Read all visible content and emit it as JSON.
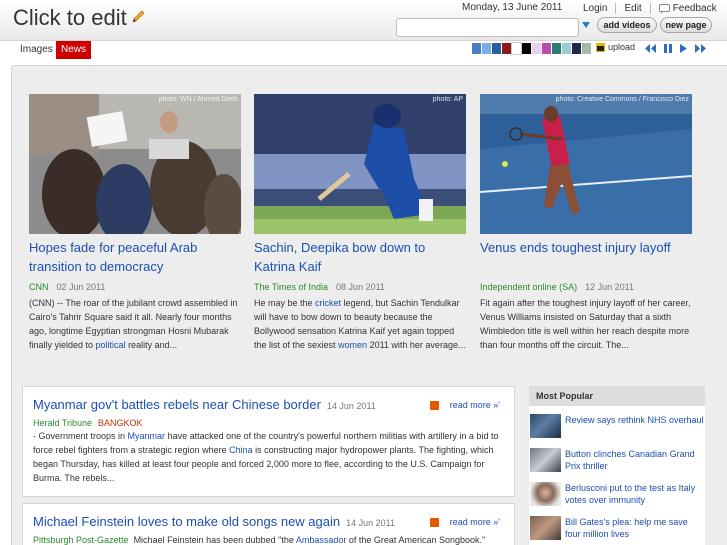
{
  "header": {
    "site_title": "Click to edit",
    "date": "Monday, 13 June 2011",
    "links": {
      "login": "Login",
      "edit": "Edit",
      "feedback": "Feedback"
    },
    "search": {
      "value": "",
      "placeholder": ""
    },
    "buttons": {
      "add_videos": "add videos",
      "new_page": "new page"
    }
  },
  "toolbar": {
    "tabs": [
      {
        "label": "Images",
        "active": false
      },
      {
        "label": "News",
        "active": true
      }
    ],
    "swatch_colors": [
      "#4a7dc6",
      "#7baee0",
      "#2a5ca0",
      "#8b1a1a",
      "#ffffff",
      "#000000",
      "#e8d0ef",
      "#b74ea8",
      "#2b7a7a",
      "#9ccbd4",
      "#1f2a4a",
      "#a8b8a8"
    ],
    "upload_label": "upload",
    "accent_color": "#cc0000"
  },
  "featured": [
    {
      "credit": "photo: WN / Ahmed Deeb",
      "title": "Hopes fade for peaceful Arab transition to democracy",
      "source": "CNN",
      "date": "02 Jun 2011",
      "summary": {
        "before": "(CNN) -- The roar of the jubilant crowd assembled in Cairo's Tahrir Square said it all. Nearly four months ago, longtime Egyptian strongman Hosni Mubarak finally yielded to ",
        "link": "political",
        "after": " reality and..."
      }
    },
    {
      "credit": "photo: AP",
      "title": "Sachin, Deepika bow down to Katrina Kaif",
      "source": "The Times of India",
      "date": "08 Jun 2011",
      "summary": {
        "before": "He may be the ",
        "link": "cricket",
        "mid": " legend, but Sachin Tendulkar will have to bow down to beauty because the Bollywood sensation Katrina Kaif yet again topped the list of the sexiest ",
        "link2": "women",
        "after": " 2011 with her average..."
      }
    },
    {
      "credit": "photo: Creative Commons / Francisco Diez",
      "title": "Venus ends toughest injury layoff",
      "source": "Independent online (SA)",
      "date": "12 Jun 2011",
      "summary": {
        "before": "Fit again after the toughest injury layoff of her career, Venus Williams insisted on Saturday that a sixth Wimbledon title is well within her reach despite more than four months off the circuit. The...",
        "link": "",
        "after": ""
      }
    }
  ],
  "stories": [
    {
      "title": "Myanmar gov't battles rebels near Chinese border",
      "date": "14 Jun 2011",
      "read_more": "read more",
      "source": "Herald Tribune",
      "location": "BANGKOK",
      "body": {
        "t1": " - Government troops in ",
        "l1": "Myanmar",
        "t2": " have attacked one of the country's powerful northern militias with artillery in a bid to force rebel fighters from a strategic region where ",
        "l2": "China",
        "t3": " is constructing major hydropower plants. The fighting, which began Thursday, has killed at least four people and forced 2,000 more to flee, according to the U.S. Campaign for Burma. The rebels..."
      }
    },
    {
      "title": "Michael Feinstein loves to make old songs new again",
      "date": "14 Jun 2011",
      "read_more": "read more",
      "source": "Pittsburgh Post-Gazette",
      "location": "",
      "body": {
        "t1": "Michael Feinstein has been dubbed \"the ",
        "l1": "Ambassador",
        "t2": " of the Great American Songbook.\"",
        "l2": "",
        "t3": ""
      }
    }
  ],
  "most_popular": {
    "heading": "Most Popular",
    "items": [
      "Review says rethink NHS overhaul",
      "Button clinches Canadian Grand Prix thriller",
      "Berlusconi put to the test as Italy votes over immunity",
      "Bill Gates's plea: help me save four million lives"
    ]
  }
}
